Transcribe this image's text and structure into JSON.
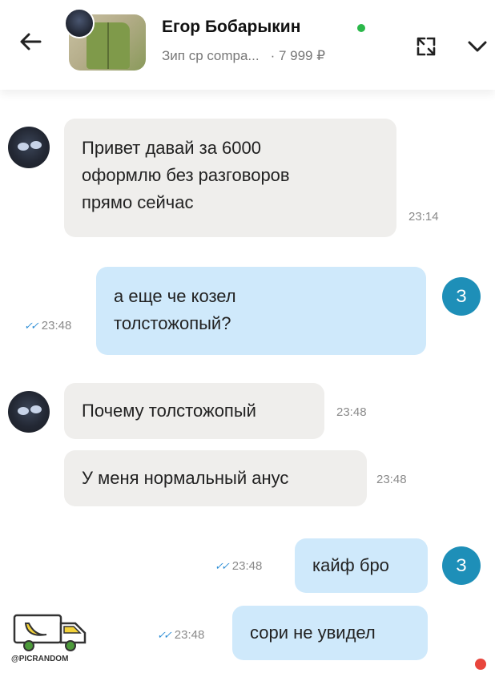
{
  "header": {
    "seller_name": "Егор Бобарыкин",
    "product_title": "Зип cp compa...",
    "product_price": "· 7 999 ₽",
    "online_color": "#2bb84a",
    "icons": {
      "back": "arrow-left-icon",
      "expand": "open-external-icon",
      "more": "chevron-down-icon"
    }
  },
  "messages": [
    {
      "side": "in",
      "text": "Привет давай за 6000\nоформлю без разговоров\nпрямо сейчас",
      "time": "23:14"
    },
    {
      "side": "out",
      "text": "а еще че козел\nтолстожопый?",
      "time": "23:48",
      "avatar": "З"
    },
    {
      "side": "in",
      "text": "Почему толстожопый",
      "time": "23:48"
    },
    {
      "side": "in",
      "text": "У меня нормальный анус",
      "time": "23:48"
    },
    {
      "side": "out",
      "text": "кайф бро",
      "time": "23:48",
      "avatar": "З"
    },
    {
      "side": "out",
      "text": "сори не увидел",
      "time": "23:48"
    }
  ],
  "colors": {
    "incoming_bubble": "#efeeec",
    "outgoing_bubble": "#cfe9fb",
    "my_avatar": "#1e8fb8",
    "read_check": "#2f8fd6"
  },
  "watermark": {
    "text": "@PICRANDOM",
    "icon": "banana-truck-icon"
  }
}
